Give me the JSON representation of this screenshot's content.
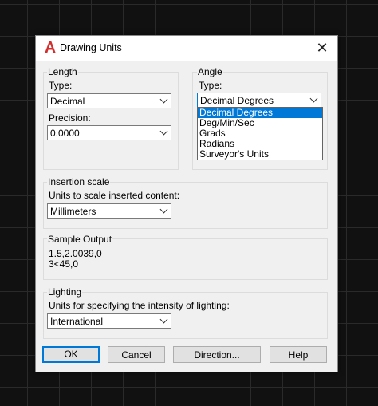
{
  "dialog": {
    "title": "Drawing Units",
    "close_glyph": "✕"
  },
  "length": {
    "group_label": "Length",
    "type_label": "Type:",
    "type_value": "Decimal",
    "precision_label": "Precision:",
    "precision_value": "0.0000"
  },
  "angle": {
    "group_label": "Angle",
    "type_label": "Type:",
    "type_value": "Decimal Degrees",
    "options": [
      "Decimal Degrees",
      "Deg/Min/Sec",
      "Grads",
      "Radians",
      "Surveyor's Units"
    ],
    "selected_index": 0
  },
  "insertion": {
    "group_label": "Insertion scale",
    "desc": "Units to scale inserted content:",
    "value": "Millimeters"
  },
  "sample": {
    "group_label": "Sample Output",
    "line1": "1.5,2.0039,0",
    "line2": "3<45,0"
  },
  "lighting": {
    "group_label": "Lighting",
    "desc": "Units for specifying the intensity of lighting:",
    "value": "International"
  },
  "buttons": {
    "ok": "OK",
    "cancel": "Cancel",
    "direction": "Direction...",
    "help": "Help"
  },
  "colors": {
    "accent": "#0078d7",
    "logo_red": "#d32f2f"
  },
  "icons": {
    "app": "autocad-logo-icon",
    "close": "close-icon",
    "dropdown": "chevron-down-icon"
  }
}
